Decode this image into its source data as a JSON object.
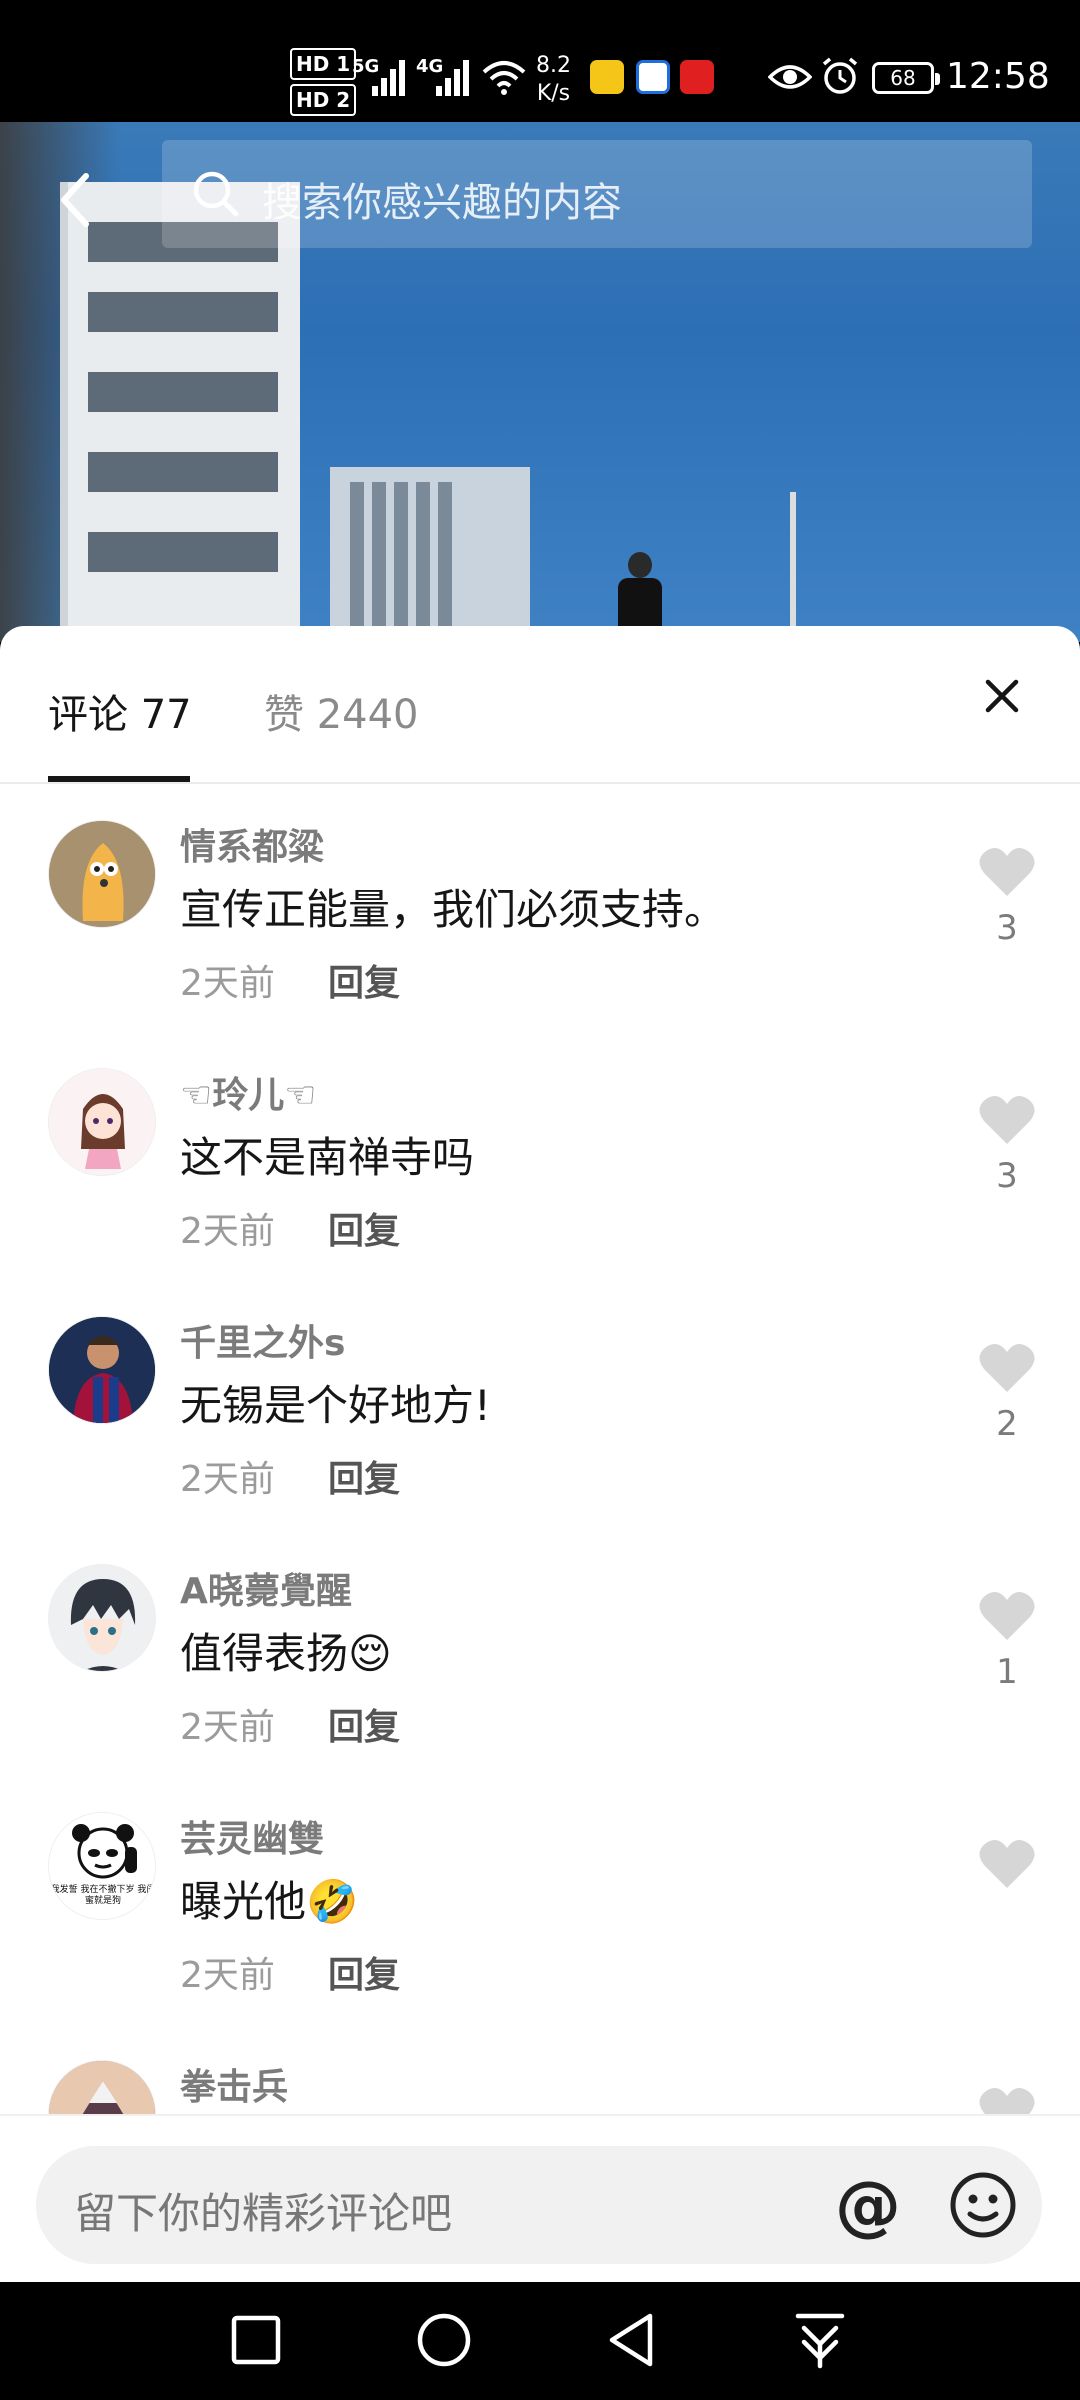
{
  "status_bar": {
    "hd1": "HD 1",
    "hd2": "HD 2",
    "sig1": "5G",
    "sig2": "4G",
    "speed_value": "8.2",
    "speed_unit": "K/s",
    "battery": "68",
    "time": "12:58"
  },
  "search": {
    "placeholder": "搜索你感兴趣的内容"
  },
  "tabs": {
    "comments": "评论 77",
    "likes": "赞 2440"
  },
  "comments": [
    {
      "name": "情系都粱",
      "text": "宣传正能量，我们必须支持。",
      "time": "2天前",
      "reply": "回复",
      "likes": "3"
    },
    {
      "name": "☜玲儿☜",
      "text": "这不是南禅寺吗",
      "time": "2天前",
      "reply": "回复",
      "likes": "3"
    },
    {
      "name": "千里之外s",
      "text": "无锡是个好地方!",
      "time": "2天前",
      "reply": "回复",
      "likes": "2"
    },
    {
      "name": "A晓薨覺醒",
      "text": "值得表扬😌",
      "time": "2天前",
      "reply": "回复",
      "likes": "1"
    },
    {
      "name": "芸灵幽雙",
      "text": "曝光他🤣",
      "time": "2天前",
      "reply": "回复",
      "likes": ""
    },
    {
      "name": "拳击兵",
      "text": "",
      "time": "",
      "reply": "",
      "likes": ""
    }
  ],
  "input": {
    "placeholder": "留下你的精彩评论吧",
    "at_symbol": "@"
  },
  "avatar_texts": {
    "panda": "我发誓 我在不撤下岁 我闺蜜就是狗"
  },
  "colors": {
    "accent": "#161616",
    "muted": "#9b9b9b",
    "heart": "#d6d6d6"
  }
}
